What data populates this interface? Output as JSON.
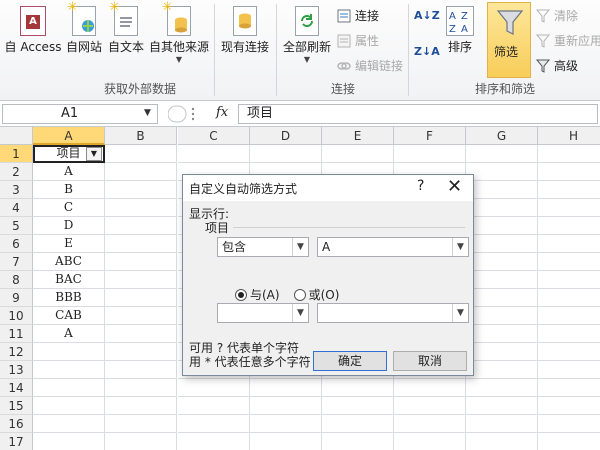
{
  "ribbon": {
    "get_external": {
      "access": "自 Access",
      "web": "自网站",
      "text": "自文本",
      "other": "自其他来源",
      "existing": "现有连接",
      "group_label": "获取外部数据"
    },
    "connections": {
      "refresh_all": "全部刷新",
      "connections": "连接",
      "properties": "属性",
      "edit_links": "编辑链接",
      "group_label": "连接"
    },
    "sort_filter": {
      "sort": "排序",
      "filter": "筛选",
      "clear": "清除",
      "reapply": "重新应用",
      "advanced": "高级",
      "group_label": "排序和筛选",
      "az": "A↓Z",
      "za": "Z↓A"
    }
  },
  "formula_bar": {
    "name_box": "A1",
    "fx": "fx",
    "value": "项目"
  },
  "grid": {
    "columns": [
      "A",
      "B",
      "C",
      "D",
      "E",
      "F",
      "G",
      "H"
    ],
    "rows": [
      "1",
      "2",
      "3",
      "4",
      "5",
      "6",
      "7",
      "8",
      "9",
      "10",
      "11",
      "12",
      "13",
      "14",
      "15",
      "16",
      "17"
    ],
    "column_a": [
      "项目",
      "A",
      "B",
      "C",
      "D",
      "E",
      "ABC",
      "BAC",
      "BBB",
      "CAB",
      "A"
    ]
  },
  "dialog": {
    "title": "自定义自动筛选方式",
    "help": "?",
    "close": "✕",
    "show_rows": "显示行:",
    "field": "项目",
    "condition1_op": "包含",
    "condition1_val": "A",
    "and_label": "与(A)",
    "or_label": "或(O)",
    "condition2_op": "",
    "condition2_val": "",
    "hint1": "可用 ? 代表单个字符",
    "hint2": "用 * 代表任意多个字符",
    "ok": "确定",
    "cancel": "取消"
  }
}
